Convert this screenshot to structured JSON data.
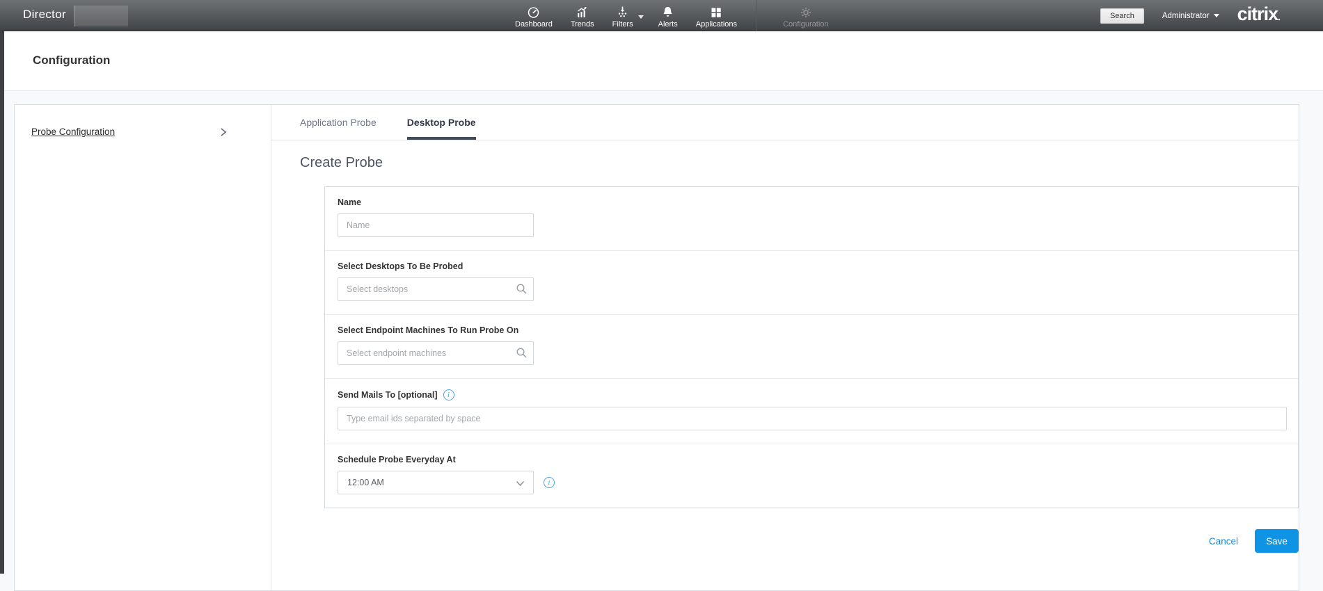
{
  "topbar": {
    "brand": "Director",
    "nav": [
      {
        "label": "Dashboard",
        "icon": "dashboard-gauge-icon"
      },
      {
        "label": "Trends",
        "icon": "trends-chart-icon"
      },
      {
        "label": "Filters",
        "icon": "filters-icon",
        "has_caret": true
      },
      {
        "label": "Alerts",
        "icon": "alerts-bell-icon"
      },
      {
        "label": "Applications",
        "icon": "applications-grid-icon"
      },
      {
        "label": "Configuration",
        "icon": "configuration-gear-icon",
        "selected": true
      }
    ],
    "search_label": "Search",
    "user_menu_label": "Administrator",
    "logo_text": "citrix",
    "logo_suffix": "."
  },
  "page": {
    "title": "Configuration"
  },
  "sidebar": {
    "items": [
      {
        "label": "Probe Configuration"
      }
    ]
  },
  "tabs": [
    {
      "label": "Application Probe",
      "active": false
    },
    {
      "label": "Desktop Probe",
      "active": true
    }
  ],
  "form": {
    "title": "Create Probe",
    "fields": [
      {
        "label": "Name",
        "placeholder": "Name",
        "type": "text"
      },
      {
        "label": "Select Desktops To Be Probed",
        "placeholder": "Select desktops",
        "type": "search"
      },
      {
        "label": "Select Endpoint Machines To Run Probe On",
        "placeholder": "Select endpoint machines",
        "type": "search"
      },
      {
        "label": "Send Mails To [optional]",
        "placeholder": "Type email ids separated by space",
        "type": "email",
        "has_info": true
      },
      {
        "label": "Schedule Probe Everyday At",
        "value": "12:00 AM",
        "type": "select",
        "has_info": true
      }
    ],
    "info_glyph": "i",
    "actions": {
      "cancel_label": "Cancel",
      "save_label": "Save"
    }
  },
  "colors": {
    "accent_blue": "#0e93e5",
    "link_blue": "#1d87d8",
    "info_blue": "#4aa3df",
    "tab_underline": "#414b5a",
    "topbar_gradient_top": "#6f7275",
    "topbar_gradient_bottom": "#404345"
  }
}
